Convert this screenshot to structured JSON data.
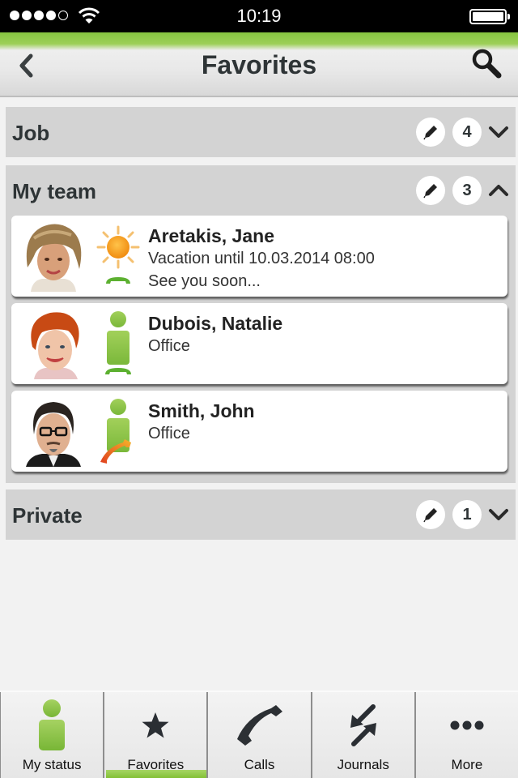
{
  "status_bar": {
    "signal_bars_filled": 4,
    "signal_bars_total": 5,
    "time": "10:19",
    "battery_level": 1.0
  },
  "header": {
    "title": "Favorites",
    "back_icon": "chevron-left-icon",
    "search_icon": "search-icon"
  },
  "colors": {
    "accent_green": "#8cc63f",
    "group_background": "#d3d3d3",
    "page_background": "#f2f2f2",
    "text_dark": "#2e3436",
    "vacation_orange": "#f7a21b",
    "call_red": "#e03c1e"
  },
  "groups": [
    {
      "title": "Job",
      "count": "4",
      "expanded": false,
      "edit_icon": "pencil-icon",
      "toggle_icon": "chevron-down-icon"
    },
    {
      "title": "My team",
      "count": "3",
      "expanded": true,
      "edit_icon": "pencil-icon",
      "toggle_icon": "chevron-up-icon",
      "contacts": [
        {
          "name": "Aretakis, Jane",
          "line1": "Vacation until 10.03.2014 08:00",
          "line2": "See you soon...",
          "presence_icon": "sun-vacation-icon",
          "phone_state": "available"
        },
        {
          "name": "Dubois, Natalie",
          "line1": "Office",
          "line2": "",
          "presence_icon": "person-available-icon",
          "phone_state": "available"
        },
        {
          "name": "Smith, John",
          "line1": "Office",
          "line2": "",
          "presence_icon": "person-available-icon",
          "phone_state": "on-call"
        }
      ]
    },
    {
      "title": "Private",
      "count": "1",
      "expanded": false,
      "edit_icon": "pencil-icon",
      "toggle_icon": "chevron-down-icon"
    }
  ],
  "tabbar": {
    "active": "Favorites",
    "tabs": [
      {
        "label": "My status",
        "icon": "person-icon"
      },
      {
        "label": "Favorites",
        "icon": "star-icon"
      },
      {
        "label": "Calls",
        "icon": "phone-icon"
      },
      {
        "label": "Journals",
        "icon": "journal-arrows-icon"
      },
      {
        "label": "More",
        "icon": "more-dots-icon"
      }
    ]
  }
}
